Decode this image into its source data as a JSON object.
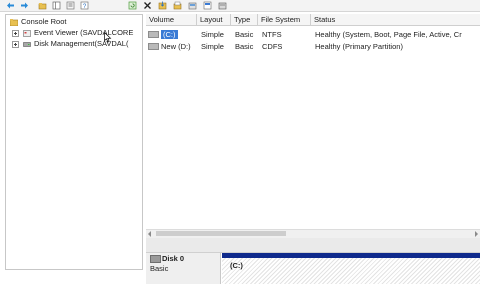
{
  "toolbar": {
    "icons": [
      "back-arrow-icon",
      "forward-arrow-icon",
      "up-folder-icon",
      "show-hide-tree-icon",
      "properties-icon",
      "help-icon",
      "refresh-icon",
      "delete-icon",
      "export-icon",
      "open-icon",
      "new-icon",
      "view-icon",
      "format-icon"
    ]
  },
  "tree": {
    "root": "Console Root",
    "items": [
      {
        "label": "Event Viewer (SAVDALCORE"
      },
      {
        "label": "Disk Management(SAVDAL("
      }
    ]
  },
  "volumes": {
    "columns": [
      "Volume",
      "Layout",
      "Type",
      "File System",
      "Status"
    ],
    "rows": [
      {
        "volume": "(C:)",
        "layout": "Simple",
        "type": "Basic",
        "fs": "NTFS",
        "status": "Healthy (System, Boot, Page File, Active, Cr"
      },
      {
        "volume": "New (D:)",
        "layout": "Simple",
        "type": "Basic",
        "fs": "CDFS",
        "status": "Healthy (Primary Partition)"
      }
    ]
  },
  "disk": {
    "name": "Disk 0",
    "type": "Basic",
    "partition_label": "(C:)"
  },
  "colors": {
    "selection": "#3a7bd5",
    "partition_bar": "#0f2a8c"
  }
}
